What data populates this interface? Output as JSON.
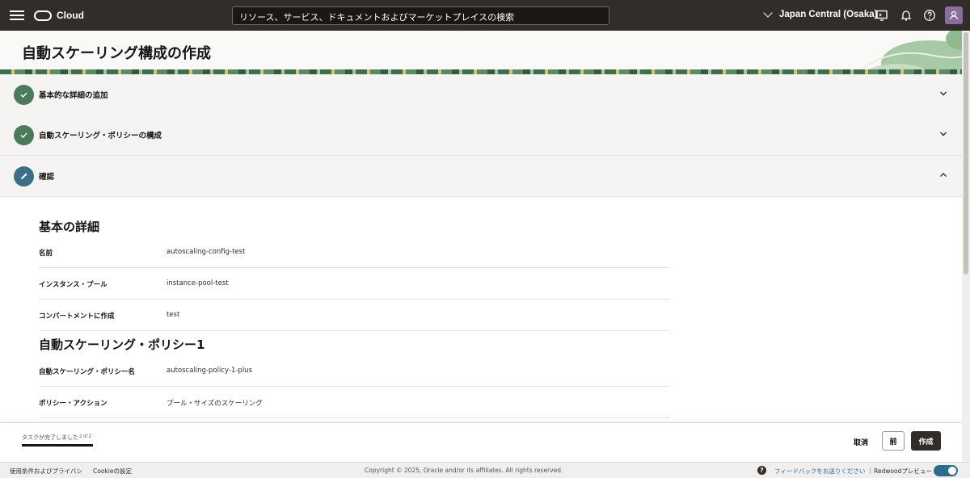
{
  "topbar": {
    "logo_text": "Cloud",
    "search_placeholder": "リソース、サービス、ドキュメントおよびマーケットプレイスの検索",
    "region": "Japan Central (Osaka)"
  },
  "page": {
    "title": "自動スケーリング構成の作成"
  },
  "steps": [
    {
      "label": "基本的な詳細の追加",
      "state": "done"
    },
    {
      "label": "自動スケーリング・ポリシーの構成",
      "state": "done"
    },
    {
      "label": "確認",
      "state": "current"
    }
  ],
  "review": {
    "basic_heading": "基本の詳細",
    "basic_rows": [
      {
        "label": "名前",
        "value": "autoscaling-config-test"
      },
      {
        "label": "インスタンス・プール",
        "value": "instance-pool-test"
      },
      {
        "label": "コンパートメントに作成",
        "value": "test"
      }
    ],
    "policy_heading": "自動スケーリング・ポリシー1",
    "policy_rows": [
      {
        "label": "自動スケーリング・ポリシー名",
        "value": "autoscaling-policy-1-plus"
      },
      {
        "label": "ポリシー・アクション",
        "value": "プール・サイズのスケーリング"
      }
    ]
  },
  "actionbar": {
    "progress_text": "タスクが完了しました",
    "progress_count": "2 of 2",
    "progress_fraction": 1.0,
    "cancel_label": "取消",
    "prev_label": "前",
    "create_label": "作成"
  },
  "footer": {
    "terms": "使用条件およびプライバシ",
    "cookie": "Cookieの設定",
    "copyright": "Copyright © 2025, Oracle and/or its affiliates. All rights reserved.",
    "help": "?",
    "feedback": "フィードバックをお送りください",
    "separator": "|",
    "redwood_preview": "Redwoodプレビュー",
    "redwood_enabled": true
  },
  "colors": {
    "topbar_bg": "#312d2a",
    "step_done": "#4a7c59",
    "step_current": "#3a6f87",
    "primary_button": "#312d2a",
    "toggle_on": "#2c6d8e"
  }
}
